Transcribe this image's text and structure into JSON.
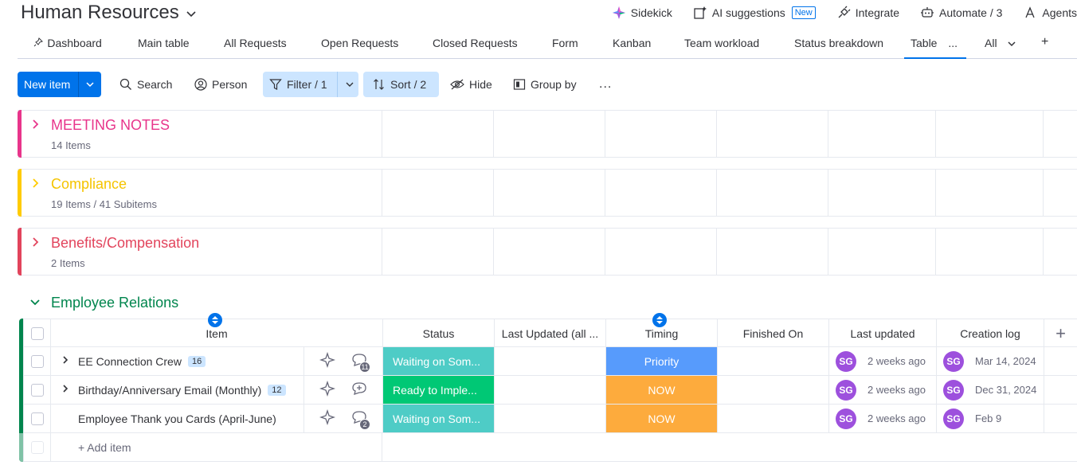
{
  "board": {
    "title": "Human Resources"
  },
  "top_actions": [
    {
      "label": "Sidekick",
      "icon": "sidekick-icon"
    },
    {
      "label": "AI suggestions",
      "icon": "ai-suggestions-icon",
      "badge": "New"
    },
    {
      "label": "Integrate",
      "icon": "integrate-icon"
    },
    {
      "label": "Automate / 3",
      "icon": "robot-icon"
    },
    {
      "label": "Agents",
      "icon": "agents-icon"
    }
  ],
  "views": {
    "tabs": [
      "Dashboard",
      "Main table",
      "All Requests",
      "Open Requests",
      "Closed Requests",
      "Form",
      "Kanban",
      "Team workload",
      "Status breakdown",
      "Table"
    ],
    "more": "...",
    "all_label": "All",
    "add": "+"
  },
  "toolbar": {
    "new_item": "New item",
    "search": "Search",
    "person": "Person",
    "filter": "Filter / 1",
    "sort": "Sort / 2",
    "hide": "Hide",
    "group_by": "Group by",
    "more": "..."
  },
  "groups": [
    {
      "name": "MEETING NOTES",
      "count": "14 Items",
      "color": "#e2445c"
    },
    {
      "name": "Compliance",
      "count": "19 Items / 41 Subitems",
      "color": "#ffcb00"
    },
    {
      "name": "Benefits/Compensation",
      "count": "2 Items",
      "color": "#e2445c"
    }
  ],
  "expanded_group": {
    "name": "Employee Relations",
    "color": "#00854d",
    "columns": {
      "item": "Item",
      "status": "Status",
      "last_updated_all": "Last Updated (all ...",
      "timing": "Timing",
      "finished_on": "Finished On",
      "last_updated": "Last updated",
      "creation_log": "Creation log",
      "add": "+"
    },
    "rows": [
      {
        "name": "EE Connection Crew",
        "subitems": "16",
        "comments": "11",
        "status": "Waiting on Som...",
        "status_color": "#4eccc6",
        "timing": "Priority",
        "timing_color": "#579bfc",
        "updated_by": "SG",
        "updated": "2 weeks ago",
        "created_by": "SG",
        "created": "Mar 14, 2024"
      },
      {
        "name": "Birthday/Anniversary Email (Monthly)",
        "subitems": "12",
        "comments": "",
        "status": "Ready to Imple...",
        "status_color": "#00c875",
        "timing": "NOW",
        "timing_color": "#fdab3d",
        "updated_by": "SG",
        "updated": "2 weeks ago",
        "created_by": "SG",
        "created": "Dec 31, 2024"
      },
      {
        "name": "Employee Thank you Cards (April-June)",
        "subitems": "",
        "comments": "2",
        "status": "Waiting on Som...",
        "status_color": "#4eccc6",
        "timing": "NOW",
        "timing_color": "#fdab3d",
        "updated_by": "SG",
        "updated": "2 weeks ago",
        "created_by": "SG",
        "created": "Feb 9"
      }
    ],
    "add_item": "+ Add item"
  }
}
